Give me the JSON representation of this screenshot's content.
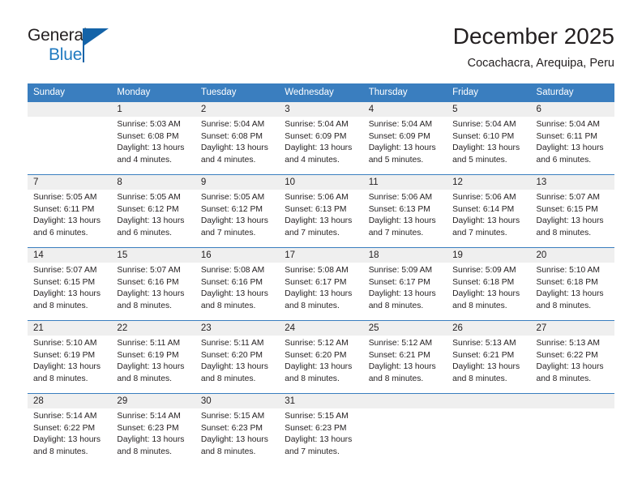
{
  "brand": {
    "name_top": "General",
    "name_bottom": "Blue",
    "accent_color": "#1463a8",
    "blue_text_color": "#1f7ac0"
  },
  "header": {
    "title": "December 2025",
    "subtitle": "Cocachacra, Arequipa, Peru"
  },
  "theme": {
    "header_bar_color": "#3a7ebf",
    "day_band_color": "#efefef",
    "text_color": "#231f20"
  },
  "weekdays": [
    "Sunday",
    "Monday",
    "Tuesday",
    "Wednesday",
    "Thursday",
    "Friday",
    "Saturday"
  ],
  "weeks": [
    [
      {
        "day": "",
        "sunrise": "",
        "sunset": "",
        "daylight_line1": "",
        "daylight_line2": "",
        "empty": true
      },
      {
        "day": "1",
        "sunrise": "Sunrise: 5:03 AM",
        "sunset": "Sunset: 6:08 PM",
        "daylight_line1": "Daylight: 13 hours",
        "daylight_line2": "and 4 minutes.",
        "empty": false
      },
      {
        "day": "2",
        "sunrise": "Sunrise: 5:04 AM",
        "sunset": "Sunset: 6:08 PM",
        "daylight_line1": "Daylight: 13 hours",
        "daylight_line2": "and 4 minutes.",
        "empty": false
      },
      {
        "day": "3",
        "sunrise": "Sunrise: 5:04 AM",
        "sunset": "Sunset: 6:09 PM",
        "daylight_line1": "Daylight: 13 hours",
        "daylight_line2": "and 4 minutes.",
        "empty": false
      },
      {
        "day": "4",
        "sunrise": "Sunrise: 5:04 AM",
        "sunset": "Sunset: 6:09 PM",
        "daylight_line1": "Daylight: 13 hours",
        "daylight_line2": "and 5 minutes.",
        "empty": false
      },
      {
        "day": "5",
        "sunrise": "Sunrise: 5:04 AM",
        "sunset": "Sunset: 6:10 PM",
        "daylight_line1": "Daylight: 13 hours",
        "daylight_line2": "and 5 minutes.",
        "empty": false
      },
      {
        "day": "6",
        "sunrise": "Sunrise: 5:04 AM",
        "sunset": "Sunset: 6:11 PM",
        "daylight_line1": "Daylight: 13 hours",
        "daylight_line2": "and 6 minutes.",
        "empty": false
      }
    ],
    [
      {
        "day": "7",
        "sunrise": "Sunrise: 5:05 AM",
        "sunset": "Sunset: 6:11 PM",
        "daylight_line1": "Daylight: 13 hours",
        "daylight_line2": "and 6 minutes.",
        "empty": false
      },
      {
        "day": "8",
        "sunrise": "Sunrise: 5:05 AM",
        "sunset": "Sunset: 6:12 PM",
        "daylight_line1": "Daylight: 13 hours",
        "daylight_line2": "and 6 minutes.",
        "empty": false
      },
      {
        "day": "9",
        "sunrise": "Sunrise: 5:05 AM",
        "sunset": "Sunset: 6:12 PM",
        "daylight_line1": "Daylight: 13 hours",
        "daylight_line2": "and 7 minutes.",
        "empty": false
      },
      {
        "day": "10",
        "sunrise": "Sunrise: 5:06 AM",
        "sunset": "Sunset: 6:13 PM",
        "daylight_line1": "Daylight: 13 hours",
        "daylight_line2": "and 7 minutes.",
        "empty": false
      },
      {
        "day": "11",
        "sunrise": "Sunrise: 5:06 AM",
        "sunset": "Sunset: 6:13 PM",
        "daylight_line1": "Daylight: 13 hours",
        "daylight_line2": "and 7 minutes.",
        "empty": false
      },
      {
        "day": "12",
        "sunrise": "Sunrise: 5:06 AM",
        "sunset": "Sunset: 6:14 PM",
        "daylight_line1": "Daylight: 13 hours",
        "daylight_line2": "and 7 minutes.",
        "empty": false
      },
      {
        "day": "13",
        "sunrise": "Sunrise: 5:07 AM",
        "sunset": "Sunset: 6:15 PM",
        "daylight_line1": "Daylight: 13 hours",
        "daylight_line2": "and 8 minutes.",
        "empty": false
      }
    ],
    [
      {
        "day": "14",
        "sunrise": "Sunrise: 5:07 AM",
        "sunset": "Sunset: 6:15 PM",
        "daylight_line1": "Daylight: 13 hours",
        "daylight_line2": "and 8 minutes.",
        "empty": false
      },
      {
        "day": "15",
        "sunrise": "Sunrise: 5:07 AM",
        "sunset": "Sunset: 6:16 PM",
        "daylight_line1": "Daylight: 13 hours",
        "daylight_line2": "and 8 minutes.",
        "empty": false
      },
      {
        "day": "16",
        "sunrise": "Sunrise: 5:08 AM",
        "sunset": "Sunset: 6:16 PM",
        "daylight_line1": "Daylight: 13 hours",
        "daylight_line2": "and 8 minutes.",
        "empty": false
      },
      {
        "day": "17",
        "sunrise": "Sunrise: 5:08 AM",
        "sunset": "Sunset: 6:17 PM",
        "daylight_line1": "Daylight: 13 hours",
        "daylight_line2": "and 8 minutes.",
        "empty": false
      },
      {
        "day": "18",
        "sunrise": "Sunrise: 5:09 AM",
        "sunset": "Sunset: 6:17 PM",
        "daylight_line1": "Daylight: 13 hours",
        "daylight_line2": "and 8 minutes.",
        "empty": false
      },
      {
        "day": "19",
        "sunrise": "Sunrise: 5:09 AM",
        "sunset": "Sunset: 6:18 PM",
        "daylight_line1": "Daylight: 13 hours",
        "daylight_line2": "and 8 minutes.",
        "empty": false
      },
      {
        "day": "20",
        "sunrise": "Sunrise: 5:10 AM",
        "sunset": "Sunset: 6:18 PM",
        "daylight_line1": "Daylight: 13 hours",
        "daylight_line2": "and 8 minutes.",
        "empty": false
      }
    ],
    [
      {
        "day": "21",
        "sunrise": "Sunrise: 5:10 AM",
        "sunset": "Sunset: 6:19 PM",
        "daylight_line1": "Daylight: 13 hours",
        "daylight_line2": "and 8 minutes.",
        "empty": false
      },
      {
        "day": "22",
        "sunrise": "Sunrise: 5:11 AM",
        "sunset": "Sunset: 6:19 PM",
        "daylight_line1": "Daylight: 13 hours",
        "daylight_line2": "and 8 minutes.",
        "empty": false
      },
      {
        "day": "23",
        "sunrise": "Sunrise: 5:11 AM",
        "sunset": "Sunset: 6:20 PM",
        "daylight_line1": "Daylight: 13 hours",
        "daylight_line2": "and 8 minutes.",
        "empty": false
      },
      {
        "day": "24",
        "sunrise": "Sunrise: 5:12 AM",
        "sunset": "Sunset: 6:20 PM",
        "daylight_line1": "Daylight: 13 hours",
        "daylight_line2": "and 8 minutes.",
        "empty": false
      },
      {
        "day": "25",
        "sunrise": "Sunrise: 5:12 AM",
        "sunset": "Sunset: 6:21 PM",
        "daylight_line1": "Daylight: 13 hours",
        "daylight_line2": "and 8 minutes.",
        "empty": false
      },
      {
        "day": "26",
        "sunrise": "Sunrise: 5:13 AM",
        "sunset": "Sunset: 6:21 PM",
        "daylight_line1": "Daylight: 13 hours",
        "daylight_line2": "and 8 minutes.",
        "empty": false
      },
      {
        "day": "27",
        "sunrise": "Sunrise: 5:13 AM",
        "sunset": "Sunset: 6:22 PM",
        "daylight_line1": "Daylight: 13 hours",
        "daylight_line2": "and 8 minutes.",
        "empty": false
      }
    ],
    [
      {
        "day": "28",
        "sunrise": "Sunrise: 5:14 AM",
        "sunset": "Sunset: 6:22 PM",
        "daylight_line1": "Daylight: 13 hours",
        "daylight_line2": "and 8 minutes.",
        "empty": false
      },
      {
        "day": "29",
        "sunrise": "Sunrise: 5:14 AM",
        "sunset": "Sunset: 6:23 PM",
        "daylight_line1": "Daylight: 13 hours",
        "daylight_line2": "and 8 minutes.",
        "empty": false
      },
      {
        "day": "30",
        "sunrise": "Sunrise: 5:15 AM",
        "sunset": "Sunset: 6:23 PM",
        "daylight_line1": "Daylight: 13 hours",
        "daylight_line2": "and 8 minutes.",
        "empty": false
      },
      {
        "day": "31",
        "sunrise": "Sunrise: 5:15 AM",
        "sunset": "Sunset: 6:23 PM",
        "daylight_line1": "Daylight: 13 hours",
        "daylight_line2": "and 7 minutes.",
        "empty": false
      },
      {
        "day": "",
        "sunrise": "",
        "sunset": "",
        "daylight_line1": "",
        "daylight_line2": "",
        "empty": true
      },
      {
        "day": "",
        "sunrise": "",
        "sunset": "",
        "daylight_line1": "",
        "daylight_line2": "",
        "empty": true
      },
      {
        "day": "",
        "sunrise": "",
        "sunset": "",
        "daylight_line1": "",
        "daylight_line2": "",
        "empty": true
      }
    ]
  ]
}
